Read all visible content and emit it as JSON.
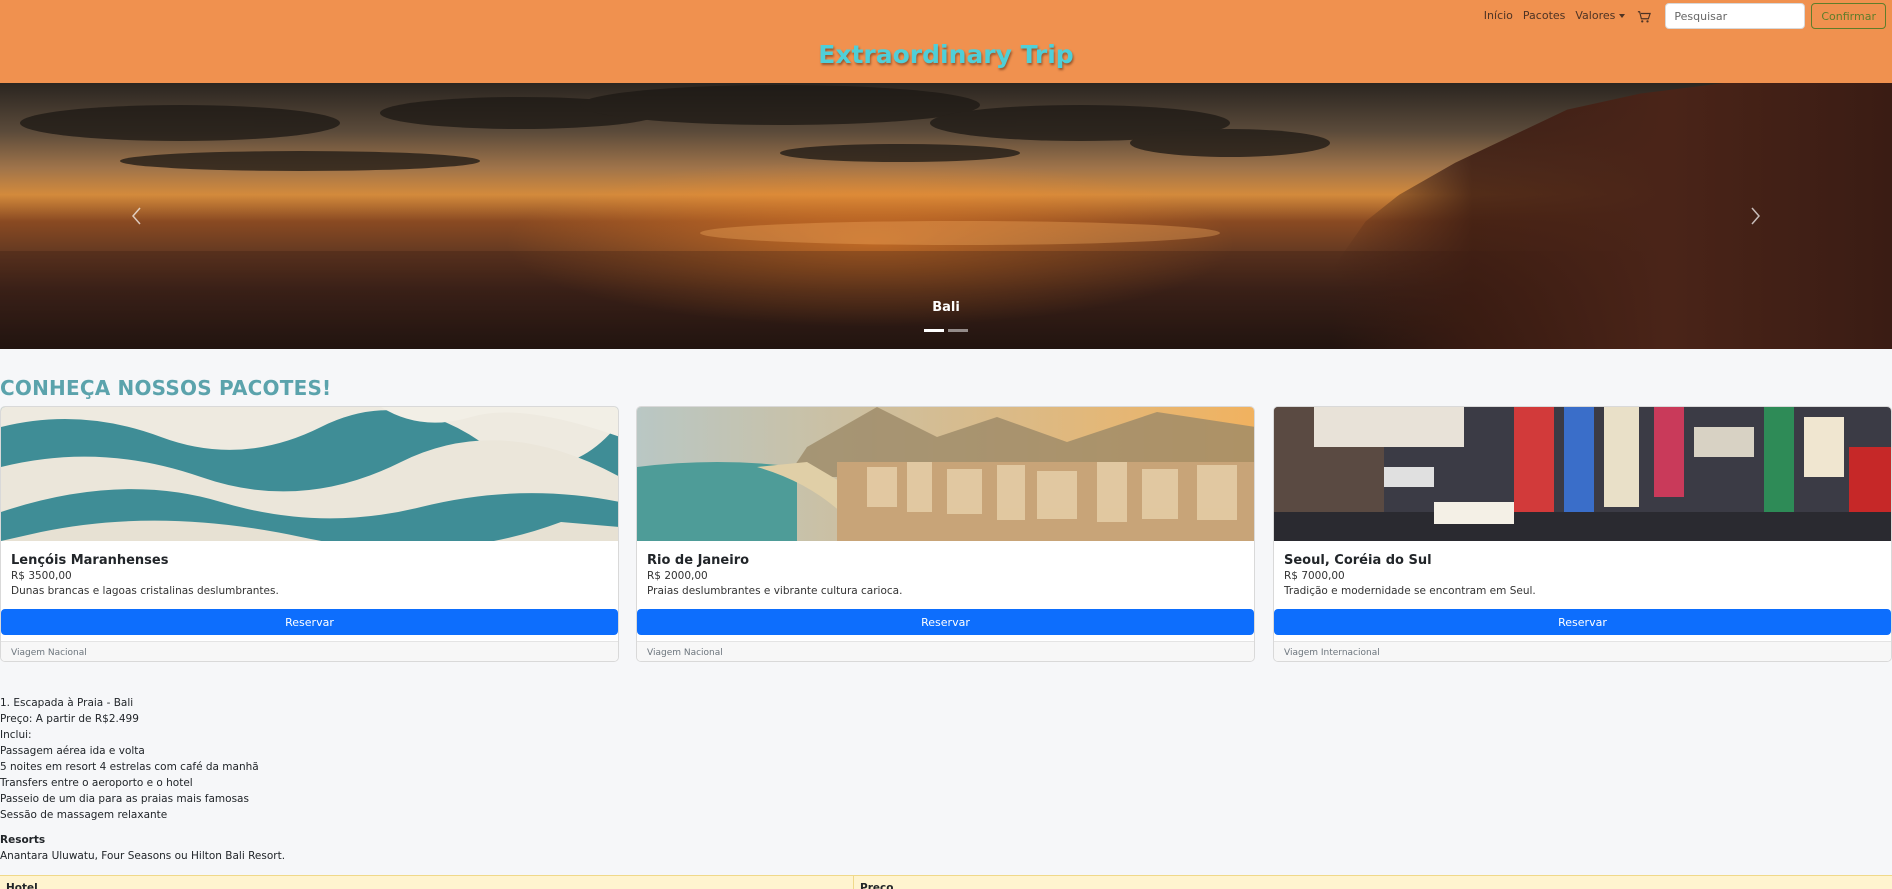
{
  "nav": {
    "links": [
      "Início",
      "Pacotes"
    ],
    "dropdown_label": "Valores",
    "search_placeholder": "Pesquisar",
    "confirm_label": "Confirmar"
  },
  "brand": "Extraordinary Trip",
  "carousel": {
    "caption": "Bali",
    "slides_count": 2,
    "active_slide": 1
  },
  "section_title": "CONHEÇA NOSSOS PACOTES!",
  "cards": [
    {
      "title": "Lençóis Maranhenses",
      "price": "R$ 3500,00",
      "description": "Dunas brancas e lagoas cristalinas deslumbrantes.",
      "button": "Reservar",
      "footer": "Viagem Nacional"
    },
    {
      "title": "Rio de Janeiro",
      "price": "R$ 2000,00",
      "description": "Praias deslumbrantes e vibrante cultura carioca.",
      "button": "Reservar",
      "footer": "Viagem Nacional"
    },
    {
      "title": "Seoul, Coréia do Sul",
      "price": "R$ 7000,00",
      "description": "Tradição e modernidade se encontram em Seul.",
      "button": "Reservar",
      "footer": "Viagem Internacional"
    }
  ],
  "package": {
    "lines": [
      "1. Escapada à Praia - Bali",
      "Preço: A partir de R$2.499",
      "Inclui:",
      "Passagem aérea ida e volta",
      "5 noites em resort 4 estrelas com café da manhã",
      "Transfers entre o aeroporto e o hotel",
      "Passeio de um dia para as praias mais famosas",
      "Sessão de massagem relaxante"
    ],
    "resorts_title": "Resorts",
    "resorts_text": "Anantara Uluwatu, Four Seasons ou Hilton Bali Resort."
  },
  "table": {
    "headers": [
      "Hotel",
      "Preço"
    ]
  },
  "colors": {
    "header_bg": "#f0914f",
    "brand_text": "#4fcfd8",
    "section_title": "#5ba3ac",
    "primary_button": "#0d6efd",
    "confirm_outline": "#5f7d2a"
  },
  "icons": [
    "cart-icon",
    "chevron-left-icon",
    "chevron-right-icon"
  ]
}
